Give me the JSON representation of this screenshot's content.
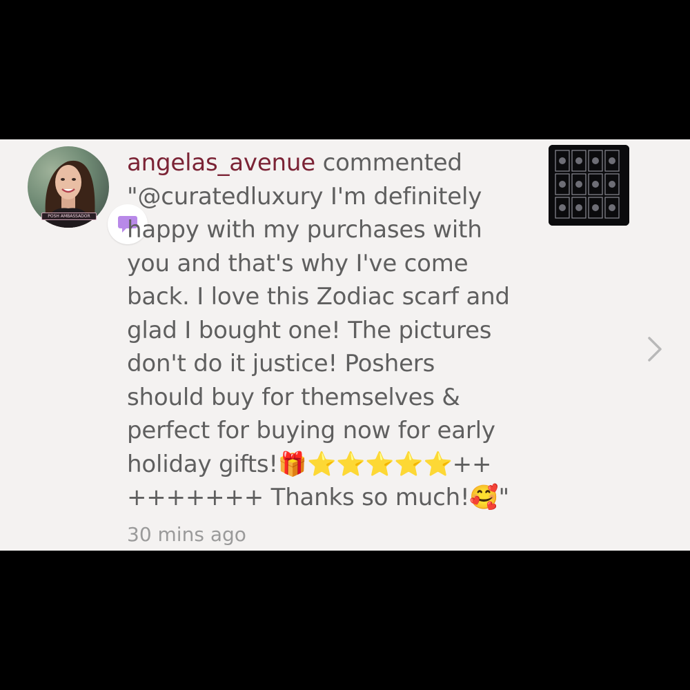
{
  "notification": {
    "username": "angelas_avenue",
    "action": "commented",
    "comment_lines": [
      "\"@curatedluxury I'm definitely",
      "happy with my purchases with",
      "you and that's why I've come",
      "back. I love this Zodiac scarf and",
      "glad I bought one! The pictures",
      "don't do it justice! Poshers",
      "should buy for themselves &",
      "perfect for buying now for early",
      "holiday gifts!🎁⭐⭐⭐⭐⭐++",
      "+++++++ Thanks so much!🥰\""
    ],
    "timestamp": "30 mins ago",
    "avatar_tag": "POSH AMBASSADOR"
  },
  "icons": {
    "badge": "speech-bubble-icon",
    "thumbnail": "zodiac-scarf-thumbnail",
    "chevron": "chevron-right-icon"
  },
  "colors": {
    "username": "#7b2335",
    "text": "#5f5f5f",
    "timestamp": "#9a9a9a",
    "background": "#f4f2f1",
    "badge_icon": "#b889e8",
    "chevron": "#b8b8b8"
  }
}
